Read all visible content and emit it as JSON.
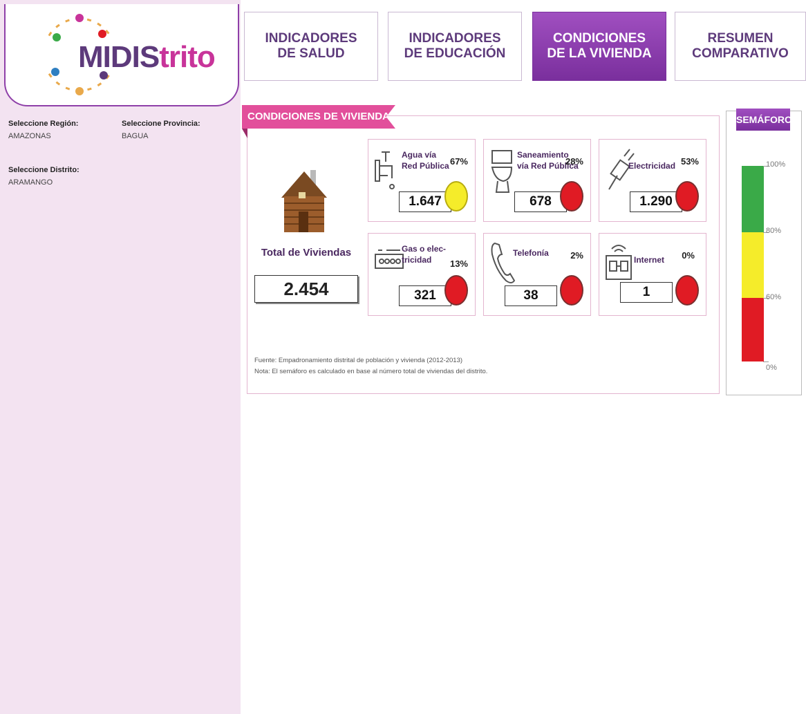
{
  "app": {
    "logo_part1": "MIDIS",
    "logo_part2": "trito"
  },
  "filters": {
    "region": {
      "label": "Seleccione Región:",
      "value": "AMAZONAS"
    },
    "provincia": {
      "label": "Seleccione Provincia:",
      "value": "BAGUA"
    },
    "distrito": {
      "label": "Seleccione Distrito:",
      "value": "ARAMANGO"
    }
  },
  "tabs": [
    {
      "label": "INDICADORES\nDE SALUD",
      "active": false
    },
    {
      "label": "INDICADORES\nDE EDUCACIÓN",
      "active": false
    },
    {
      "label": "CONDICIONES\nDE LA VIVIENDA",
      "active": true
    },
    {
      "label": "RESUMEN\nCOMPARATIVO",
      "active": false
    }
  ],
  "section": {
    "title": "CONDICIONES DE VIVIENDA"
  },
  "total": {
    "label": "Total de Viviendas",
    "value": "2.454"
  },
  "indicators": [
    {
      "name": "Agua vía\nRed Pública",
      "pct": "67%",
      "count": "1.647",
      "status": "yellow",
      "icon": "faucet-icon"
    },
    {
      "name": "Saneamiento\nvía Red Pública",
      "pct": "28%",
      "count": "678",
      "status": "red",
      "icon": "toilet-icon"
    },
    {
      "name": "Electricidad",
      "pct": "53%",
      "count": "1.290",
      "status": "red",
      "icon": "plug-icon"
    },
    {
      "name": "Gas o elec-\ntricidad",
      "pct": "13%",
      "count": "321",
      "status": "red",
      "icon": "stove-icon"
    },
    {
      "name": "Telefonía",
      "pct": "2%",
      "count": "38",
      "status": "red",
      "icon": "phone-icon"
    },
    {
      "name": "Internet",
      "pct": "0%",
      "count": "1",
      "status": "red",
      "icon": "router-icon"
    }
  ],
  "status_colors": {
    "yellow": "#f5ec2a",
    "red": "#e01b24",
    "green": "#3aaa48"
  },
  "footnotes": {
    "source": "Fuente: Empadronamiento distrital de población y vivienda (2012-2013)",
    "note": "Nota: El semáforo es calculado en base al número total de viviendas del distrito."
  },
  "semaforo": {
    "title": "SEMÁFORO",
    "levels": [
      "100%",
      "80%",
      "60%",
      "0%"
    ]
  }
}
